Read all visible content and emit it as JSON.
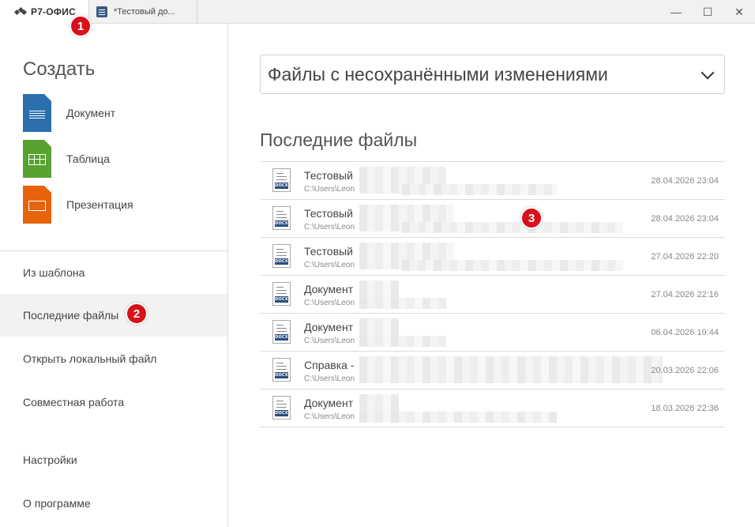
{
  "titlebar": {
    "logo": "Р7-ОФИС",
    "doc_tab": "*Тестовый до...",
    "controls": {
      "minimize": "—",
      "maximize": "☐",
      "close": "✕"
    }
  },
  "badges": [
    "1",
    "2",
    "3"
  ],
  "create": {
    "title": "Создать",
    "items": [
      {
        "label": "Документ",
        "color": "#2c6fad",
        "icon": "document-icon"
      },
      {
        "label": "Таблица",
        "color": "#59a130",
        "icon": "spreadsheet-icon"
      },
      {
        "label": "Презентация",
        "color": "#e8640c",
        "icon": "presentation-icon"
      }
    ]
  },
  "nav": {
    "items": [
      {
        "label": "Из шаблона"
      },
      {
        "label": "Последние файлы",
        "active": true
      },
      {
        "label": "Открыть локальный файл"
      },
      {
        "label": "Совместная работа"
      },
      {
        "label": "Настройки"
      },
      {
        "label": "О программе"
      }
    ]
  },
  "main": {
    "dropdown": "Файлы с несохранёнными изменениями",
    "section_title": "Последние файлы",
    "files": [
      {
        "name": "Тестовый",
        "path": "C:\\Users\\Leon",
        "date": "28.04.2026 23:04",
        "type": "DOCX"
      },
      {
        "name": "Тестовый",
        "path": "C:\\Users\\Leon",
        "date": "28.04.2026 23:04",
        "type": "DOCX"
      },
      {
        "name": "Тестовый",
        "path": "C:\\Users\\Leon",
        "date": "27.04.2026 22:20",
        "type": "DOCX"
      },
      {
        "name": "Документ",
        "path": "C:\\Users\\Leon",
        "date": "27.04.2026 22:16",
        "type": "DOCX"
      },
      {
        "name": "Документ",
        "path": "C:\\Users\\Leon",
        "date": "06.04.2026 19:44",
        "type": "DOCX"
      },
      {
        "name": "Справка -",
        "path": "C:\\Users\\Leon",
        "date": "20.03.2026 22:06",
        "type": "DOCX"
      },
      {
        "name": "Документ",
        "path": "C:\\Users\\Leon",
        "date": "18.03.2026 22:36",
        "type": "DOCX"
      }
    ]
  }
}
